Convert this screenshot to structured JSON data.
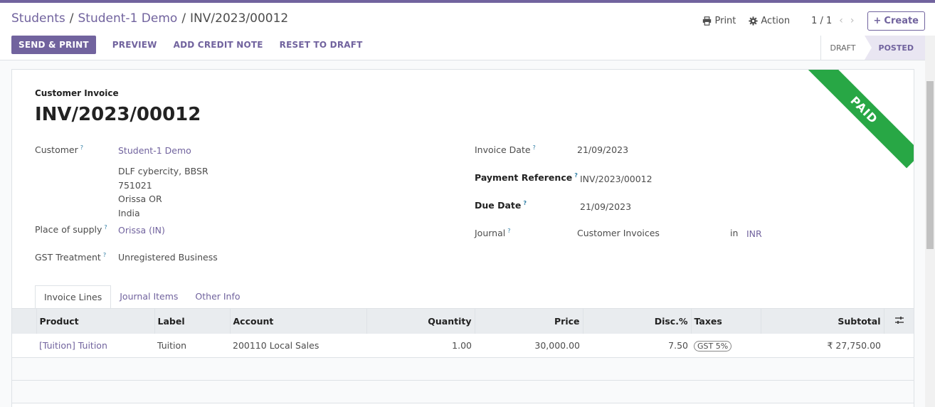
{
  "breadcrumb": {
    "items": [
      "Students",
      "Student-1 Demo"
    ],
    "current": "INV/2023/00012"
  },
  "toolbar": {
    "print_label": "Print",
    "action_label": "Action",
    "pager": "1 / 1",
    "create_label": "Create",
    "prev_glyph": "‹",
    "next_glyph": "›"
  },
  "actions": {
    "send_print": "SEND & PRINT",
    "preview": "PREVIEW",
    "add_credit_note": "ADD CREDIT NOTE",
    "reset_to_draft": "RESET TO DRAFT"
  },
  "status": {
    "draft": "DRAFT",
    "posted": "POSTED"
  },
  "ribbon": "PAID",
  "invoice": {
    "type": "Customer Invoice",
    "name": "INV/2023/00012",
    "customer_label": "Customer",
    "customer": "Student-1 Demo",
    "address": [
      "DLF cybercity, BBSR",
      "751021",
      "Orissa OR",
      "India"
    ],
    "place_of_supply_label": "Place of supply",
    "place_of_supply": "Orissa (IN)",
    "gst_treatment_label": "GST Treatment",
    "gst_treatment": "Unregistered Business",
    "invoice_date_label": "Invoice Date",
    "invoice_date": "21/09/2023",
    "payment_reference_label": "Payment Reference",
    "payment_reference": "INV/2023/00012",
    "due_date_label": "Due Date",
    "due_date": "21/09/2023",
    "journal_label": "Journal",
    "journal": "Customer Invoices",
    "in_label": "in",
    "currency": "INR"
  },
  "tabs": [
    "Invoice Lines",
    "Journal Items",
    "Other Info"
  ],
  "lines": {
    "headers": [
      "Product",
      "Label",
      "Account",
      "Quantity",
      "Price",
      "Disc.%",
      "Taxes",
      "Subtotal"
    ],
    "rows": [
      {
        "product": "[Tuition] Tuition",
        "label": "Tuition",
        "account": "200110 Local Sales",
        "quantity": "1.00",
        "price": "30,000.00",
        "disc": "7.50",
        "taxes": "GST 5%",
        "subtotal": "₹ 27,750.00"
      }
    ]
  },
  "colors": {
    "brand": "#71639e",
    "paid": "#28a745"
  }
}
